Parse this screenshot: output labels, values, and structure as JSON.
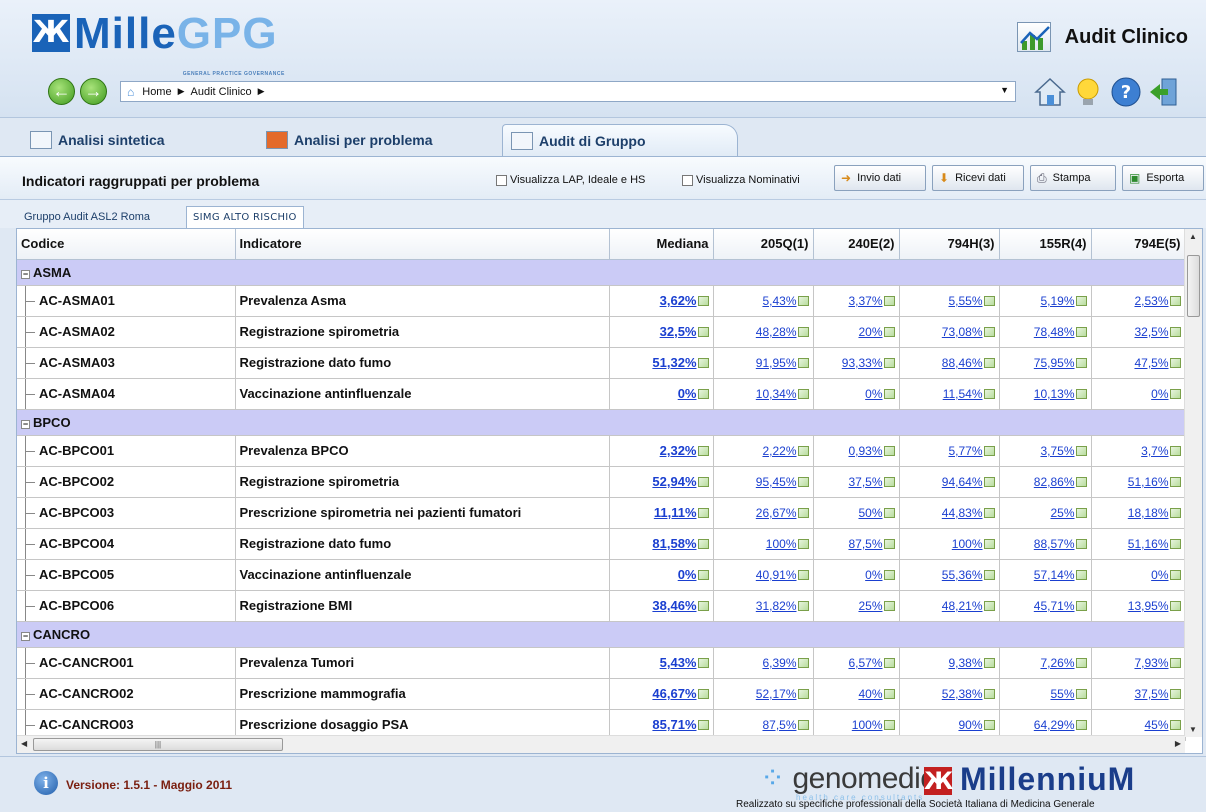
{
  "header": {
    "logo_text_a": "Mille",
    "logo_text_b": "GPG",
    "logo_subtitle": "GENERAL PRACTICE GOVERNANCE",
    "app_title": "Audit Clinico",
    "breadcrumb": [
      "Home",
      "Audit Clinico"
    ]
  },
  "tabs": [
    {
      "label": "Analisi sintetica",
      "active": false
    },
    {
      "label": "Analisi per problema",
      "active": false
    },
    {
      "label": "Audit di Gruppo",
      "active": true
    }
  ],
  "toolbar": {
    "title": "Indicatori raggruppati per problema",
    "check_lap": "Visualizza LAP, Ideale e HS",
    "check_nominativi": "Visualizza Nominativi",
    "btn_invio": "Invio dati",
    "btn_ricevi": "Ricevi dati",
    "btn_stampa": "Stampa",
    "btn_esporta": "Esporta"
  },
  "subtabs": [
    "Gruppo Audit ASL2 Roma",
    "SIMG ALTO RISCHIO"
  ],
  "grid": {
    "columns": [
      "Codice",
      "Indicatore",
      "Mediana",
      "205Q(1)",
      "240E(2)",
      "794H(3)",
      "155R(4)",
      "794E(5)"
    ],
    "groups": [
      {
        "name": "ASMA",
        "rows": [
          {
            "code": "AC-ASMA01",
            "indicator": "Prevalenza Asma",
            "values": [
              "3,62%",
              "5,43%",
              "3,37%",
              "5,55%",
              "5,19%",
              "2,53%"
            ]
          },
          {
            "code": "AC-ASMA02",
            "indicator": "Registrazione spirometria",
            "values": [
              "32,5%",
              "48,28%",
              "20%",
              "73,08%",
              "78,48%",
              "32,5%"
            ]
          },
          {
            "code": "AC-ASMA03",
            "indicator": "Registrazione dato fumo",
            "values": [
              "51,32%",
              "91,95%",
              "93,33%",
              "88,46%",
              "75,95%",
              "47,5%"
            ]
          },
          {
            "code": "AC-ASMA04",
            "indicator": "Vaccinazione antinfluenzale",
            "values": [
              "0%",
              "10,34%",
              "0%",
              "11,54%",
              "10,13%",
              "0%"
            ]
          }
        ]
      },
      {
        "name": "BPCO",
        "rows": [
          {
            "code": "AC-BPCO01",
            "indicator": "Prevalenza BPCO",
            "values": [
              "2,32%",
              "2,22%",
              "0,93%",
              "5,77%",
              "3,75%",
              "3,7%"
            ]
          },
          {
            "code": "AC-BPCO02",
            "indicator": "Registrazione spirometria",
            "values": [
              "52,94%",
              "95,45%",
              "37,5%",
              "94,64%",
              "82,86%",
              "51,16%"
            ]
          },
          {
            "code": "AC-BPCO03",
            "indicator": "Prescrizione spirometria nei pazienti fumatori",
            "values": [
              "11,11%",
              "26,67%",
              "50%",
              "44,83%",
              "25%",
              "18,18%"
            ]
          },
          {
            "code": "AC-BPCO04",
            "indicator": "Registrazione dato fumo",
            "values": [
              "81,58%",
              "100%",
              "87,5%",
              "100%",
              "88,57%",
              "51,16%"
            ]
          },
          {
            "code": "AC-BPCO05",
            "indicator": "Vaccinazione antinfluenzale",
            "values": [
              "0%",
              "40,91%",
              "0%",
              "55,36%",
              "57,14%",
              "0%"
            ]
          },
          {
            "code": "AC-BPCO06",
            "indicator": "Registrazione BMI",
            "values": [
              "38,46%",
              "31,82%",
              "25%",
              "48,21%",
              "45,71%",
              "13,95%"
            ]
          }
        ]
      },
      {
        "name": "CANCRO",
        "rows": [
          {
            "code": "AC-CANCRO01",
            "indicator": "Prevalenza Tumori",
            "values": [
              "5,43%",
              "6,39%",
              "6,57%",
              "9,38%",
              "7,26%",
              "7,93%"
            ]
          },
          {
            "code": "AC-CANCRO02",
            "indicator": "Prescrizione mammografia",
            "values": [
              "46,67%",
              "52,17%",
              "40%",
              "52,38%",
              "55%",
              "37,5%"
            ]
          },
          {
            "code": "AC-CANCRO03",
            "indicator": "Prescrizione dosaggio PSA",
            "values": [
              "85,71%",
              "87,5%",
              "100%",
              "90%",
              "64,29%",
              "45%"
            ]
          }
        ]
      }
    ]
  },
  "footer": {
    "version": "Versione: 1.5.1 - Maggio 2011",
    "brand1": "genomedics",
    "brand1_sub": "health care consultants",
    "brand2": "MillenniuM",
    "credit": "Realizzato su specifiche professionali della Società Italiana di Medicina Generale"
  },
  "colors": {
    "group_row": "#cbcbf6",
    "link_value": "#1a3fd0",
    "logo_blue": "#1a63b8"
  },
  "icons": [
    "back-icon",
    "forward-icon",
    "home-icon",
    "lightbulb-icon",
    "help-icon",
    "exit-icon",
    "chart-icon",
    "info-icon"
  ]
}
